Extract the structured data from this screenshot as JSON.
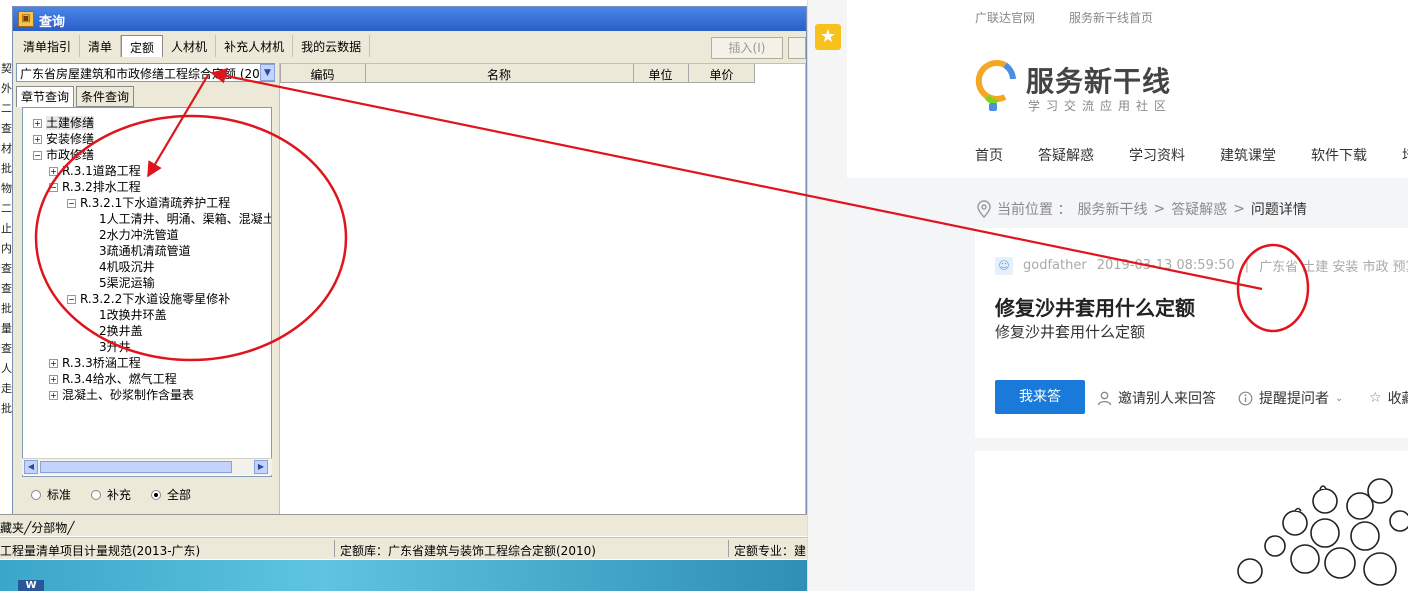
{
  "desktop": {
    "strip_chars": [
      "契",
      "外",
      "二",
      "查",
      "材",
      "批",
      "物",
      "二",
      "止",
      "内",
      "查",
      "查",
      "批",
      "量",
      "查",
      "人",
      "走",
      "批"
    ]
  },
  "window": {
    "title": "查询",
    "tabs": [
      "清单指引",
      "清单",
      "定额",
      "人材机",
      "补充人材机",
      "我的云数据"
    ],
    "active_tab": 2,
    "insert_button": "插入(I)",
    "quota_select": "广东省房屋建筑和市政修缮工程综合定额 (20:",
    "subtabs": [
      "章节查询",
      "条件查询"
    ],
    "tree": [
      {
        "label": "土建修缮",
        "exp": "+"
      },
      {
        "label": "安装修缮",
        "exp": "+"
      },
      {
        "label": "市政修缮",
        "exp": "−"
      },
      {
        "label": "R.3.1道路工程",
        "exp": "+"
      },
      {
        "label": "R.3.2排水工程",
        "exp": "−"
      },
      {
        "label": "R.3.2.1下水道清疏养护工程",
        "exp": "−"
      },
      {
        "label": "1人工清井、明涌、渠箱、混凝土",
        "exp": ""
      },
      {
        "label": "2水力冲洗管道",
        "exp": ""
      },
      {
        "label": "3疏通机清疏管道",
        "exp": ""
      },
      {
        "label": "4机吸沉井",
        "exp": ""
      },
      {
        "label": "5渠泥运输",
        "exp": ""
      },
      {
        "label": "R.3.2.2下水道设施零星修补",
        "exp": "−"
      },
      {
        "label": "1改换井环盖",
        "exp": ""
      },
      {
        "label": "2换井盖",
        "exp": ""
      },
      {
        "label": "3升井",
        "exp": ""
      },
      {
        "label": "R.3.3桥涵工程",
        "exp": "+"
      },
      {
        "label": "R.3.4给水、燃气工程",
        "exp": "+"
      },
      {
        "label": "混凝土、砂浆制作含量表",
        "exp": "+"
      }
    ],
    "radios": [
      {
        "label": "标准",
        "checked": false
      },
      {
        "label": "补充",
        "checked": false
      },
      {
        "label": "全部",
        "checked": true
      }
    ],
    "grid_columns": [
      "编码",
      "名称",
      "单位",
      "单价"
    ]
  },
  "under_tab": "藏夹╱分部物╱",
  "status": {
    "spec": "工程量清单项目计量规范(2013-广东)",
    "library": "定额库：广东省建筑与装饰工程综合定额(2010)",
    "major": "定额专业：建"
  },
  "taskbar_app": "W",
  "web": {
    "top_links": [
      "广联达官网",
      "服务新干线首页"
    ],
    "logo_title": "服务新干线",
    "logo_sub": "学习交流应用社区",
    "nav": [
      "首页",
      "答疑解惑",
      "学习资料",
      "建筑课堂",
      "软件下载",
      "培"
    ],
    "crumb": [
      "当前位置 ：",
      "服务新干线",
      ">",
      "答疑解惑",
      ">",
      "问题详情"
    ],
    "user": "godfather",
    "datetime": "2019-03-13 08:59:50",
    "divider": "|",
    "tags": "广东省  土建 安装 市政 预算",
    "question_title": "修复沙井套用什么定额",
    "question_body": "修复沙井套用什么定额",
    "answer_btn": "我来答",
    "invite": "邀请别人来回答",
    "remind": "提醒提问者",
    "collect": "收藏"
  },
  "annotation_color": "#e0141c"
}
